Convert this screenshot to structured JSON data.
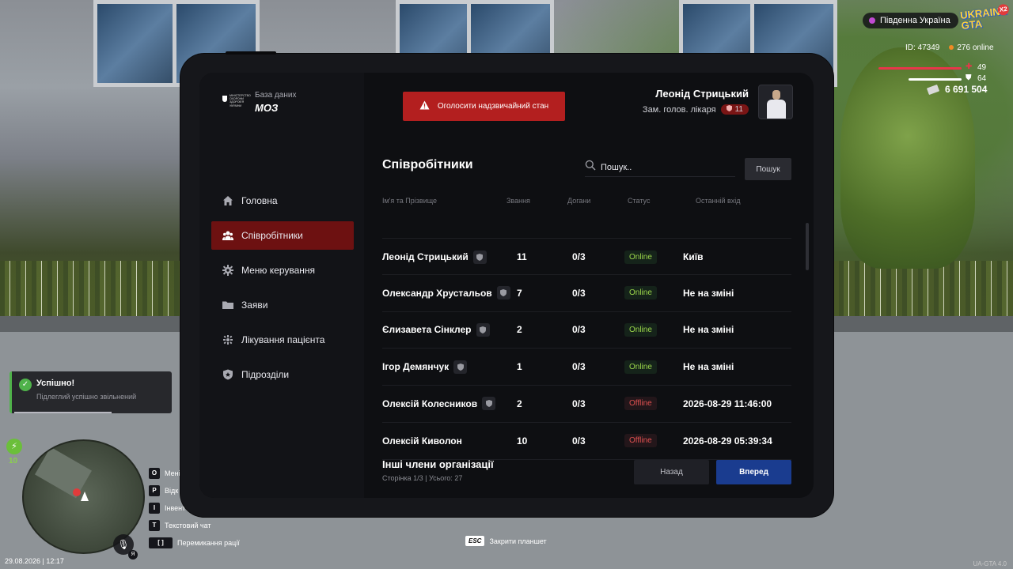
{
  "hud": {
    "region": "Південна Україна",
    "logo": "UKRAINE GTA",
    "logo_multiplier": "X2",
    "player_id": "ID: 47349",
    "online": "276 online",
    "health": "49",
    "armor": "64",
    "money": "6 691 504",
    "energy": "10",
    "datetime": "29.08.2026 | 12:17",
    "version": "UA-GTA 4.0",
    "colors": {
      "health": "#e8364a",
      "armor": "#ffffff",
      "online": "#f08a24",
      "region": "#c04bd2"
    }
  },
  "toast": {
    "title": "Успішно!",
    "message": "Підлеглий успішно звільнений",
    "color": "#4fb24a"
  },
  "keybinds": [
    {
      "key": "O",
      "label": "Мені"
    },
    {
      "key": "P",
      "label": "Відк"
    },
    {
      "key": "I",
      "label": "Інвент"
    },
    {
      "key": "T",
      "label": "Текстовий чат"
    },
    {
      "key": "[ ]",
      "label": "Перемикання рації"
    }
  ],
  "mic_label": "Я",
  "esc_hint": {
    "key": "ESC",
    "label": "Закрити планшет"
  },
  "tablet": {
    "org_logo_text": "МІНІСТЕРСТВО ОХОРОНИ ЗДОРОВ'Я УКРАЇНИ",
    "org_subtitle": "База даних",
    "org_name": "МОЗ",
    "alarm_button": "Оголосити надзвичайний стан",
    "user": {
      "name": "Леонід Стрицький",
      "rank": "Зам. голов. лікаря",
      "rank_level": "11"
    },
    "nav": [
      {
        "label": "Головна",
        "icon": "home-icon"
      },
      {
        "label": "Співробітники",
        "icon": "users-icon",
        "active": true
      },
      {
        "label": "Меню керування",
        "icon": "gear-icon"
      },
      {
        "label": "Заяви",
        "icon": "folder-icon"
      },
      {
        "label": "Лікування пацієнта",
        "icon": "heal-icon"
      },
      {
        "label": "Підрозділи",
        "icon": "shield-icon"
      }
    ],
    "section_title": "Співробітники",
    "search": {
      "placeholder": "Пошук..",
      "button": "Пошук"
    },
    "columns": [
      "Ім'я та Прізвище",
      "Звання",
      "Догани",
      "Статус",
      "Останній вхід"
    ],
    "rows": [
      {
        "name": "Леонід Стрицький",
        "rank": "11",
        "warnings": "0/3",
        "status": "Online",
        "last": "Київ"
      },
      {
        "name": "Олександр Хрустальов",
        "rank": "7",
        "warnings": "0/3",
        "status": "Online",
        "last": "Не на зміні"
      },
      {
        "name": "Єлизавета Сінклер",
        "rank": "2",
        "warnings": "0/3",
        "status": "Online",
        "last": "Не на зміні"
      },
      {
        "name": "Ігор Демянчук",
        "rank": "1",
        "warnings": "0/3",
        "status": "Online",
        "last": "Не на зміні"
      },
      {
        "name": "Олексій Колесников",
        "rank": "2",
        "warnings": "0/3",
        "status": "Offline",
        "last": "2026-08-29 11:46:00"
      },
      {
        "name": "Олексій Киволон",
        "rank": "10",
        "warnings": "0/3",
        "status": "Offline",
        "last": "2026-08-29 05:39:34",
        "no_badge": true
      }
    ],
    "others_title": "Інші члени організації",
    "pager": "Сторінка 1/3 | Усього: 27",
    "btn_back": "Назад",
    "btn_next": "Вперед",
    "colors": {
      "active_nav": "#6d1111",
      "alarm": "#b31f1f",
      "next": "#1a3c8f",
      "online": "#9bd64a",
      "offline": "#e05050"
    }
  }
}
